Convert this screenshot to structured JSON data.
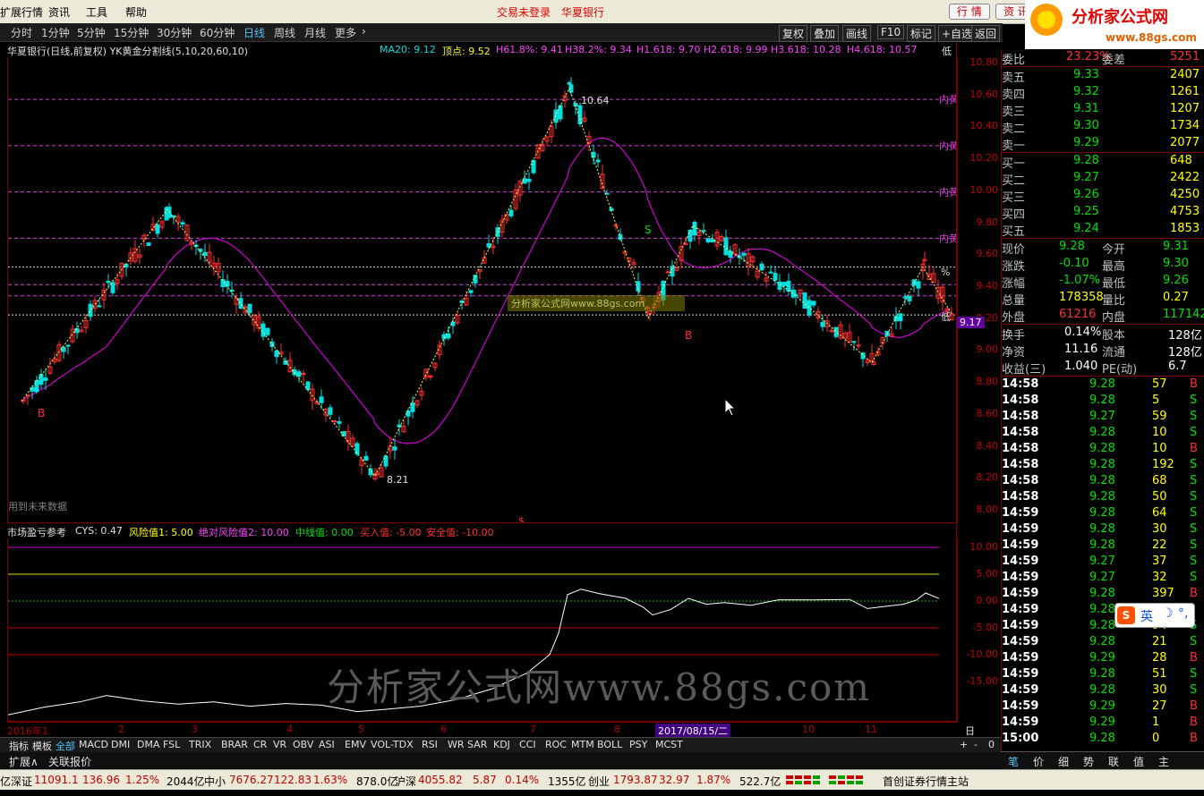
{
  "menu": {
    "items": [
      "扩展行情",
      "资讯",
      "工具",
      "帮助"
    ],
    "login_status": "交易未登录",
    "stock_name": "华夏银行",
    "btn_quote": "行 情",
    "btn_info": "资 讯"
  },
  "logo": {
    "name": "分析家公式网",
    "url": "www.88gs.com"
  },
  "period": {
    "items": [
      "分时",
      "1分钟",
      "5分钟",
      "15分钟",
      "30分钟",
      "60分钟",
      "日线",
      "周线",
      "月线",
      "更多"
    ],
    "active": "日线",
    "right_buttons": [
      "复权",
      "叠加",
      "画线",
      "F10",
      "标记",
      "+自选",
      "返回"
    ]
  },
  "chart_info": {
    "title": "华夏银行(日线,前复权) YK黄金分割线(5,10,20,60,10)",
    "ma20": "MA20: 9.12",
    "top": "顶点: 9.52",
    "h618": "H61.8%: 9.41",
    "h382": "H38.2%: 9.34",
    "h1618": "H1.618: 9.70",
    "h2618": "H2.618: 9.99",
    "h3618": "H3.618: 10.28",
    "h4618": "H4.618: 10.57",
    "low": "低"
  },
  "main_annotations": {
    "high_label": "10.64",
    "low_label": "8.21",
    "b1": "B",
    "b2": "B",
    "s1": "S",
    "future_data": "用到未来数据",
    "price_tag": "9.17",
    "inner_label": "内黄",
    "pct_label": "%",
    "low_tag": "低",
    "dollar": "$",
    "yaxis_labels": [
      "10.80",
      "10.60",
      "10.40",
      "10.20",
      "10.00",
      "9.80",
      "9.60",
      "9.40",
      "9.20",
      "9.00",
      "8.80",
      "8.60",
      "8.40",
      "8.20",
      "8.00"
    ]
  },
  "sub_info": {
    "title": "市场盈亏参考",
    "cys": "CYS: 0.47",
    "risk1": "风险值1: 5.00",
    "risk2": "绝对风险值2: 10.00",
    "mid": "中线值: 0.00",
    "buy": "买入值: -5.00",
    "safe": "安全值: -10.00",
    "yaxis_labels": [
      "10.00",
      "5.00",
      "0.00",
      "-5.00",
      "-10.00",
      "-15.00"
    ]
  },
  "date_axis": {
    "labels": [
      "2016年1",
      "2",
      "3",
      "4",
      "5",
      "6",
      "7",
      "8",
      "9",
      "10",
      "11"
    ],
    "highlight": "2017/08/15/二",
    "period_label": "日线"
  },
  "tabs": {
    "items": [
      "指标",
      "模板",
      "全部",
      "MACD",
      "DMI",
      "DMA",
      "FSL",
      "TRIX",
      "BRAR",
      "CR",
      "VR",
      "OBV",
      "ASI",
      "EMV",
      "VOL-TDX",
      "RSI",
      "WR",
      "SAR",
      "KDJ",
      "CCI",
      "ROC",
      "MTM",
      "BOLL",
      "PSY",
      "MCST"
    ],
    "active": "全部",
    "row2": [
      "扩展∧",
      "关联报价"
    ],
    "zoom": [
      "+",
      "-",
      "0"
    ]
  },
  "order_book": {
    "weibi": {
      "label": "委比",
      "value": "23.23%",
      "diff_label": "委差",
      "diff": "5251"
    },
    "asks": [
      {
        "label": "卖五",
        "price": "9.33",
        "vol": "2407"
      },
      {
        "label": "卖四",
        "price": "9.32",
        "vol": "1261"
      },
      {
        "label": "卖三",
        "price": "9.31",
        "vol": "1207"
      },
      {
        "label": "卖二",
        "price": "9.30",
        "vol": "1734"
      },
      {
        "label": "卖一",
        "price": "9.29",
        "vol": "2077"
      }
    ],
    "bids": [
      {
        "label": "买一",
        "price": "9.28",
        "vol": "648"
      },
      {
        "label": "买二",
        "price": "9.27",
        "vol": "2422"
      },
      {
        "label": "买三",
        "price": "9.26",
        "vol": "4250"
      },
      {
        "label": "买四",
        "price": "9.25",
        "vol": "4753"
      },
      {
        "label": "买五",
        "price": "9.24",
        "vol": "1853"
      }
    ]
  },
  "quote": [
    {
      "l1": "现价",
      "v1": "9.28",
      "l2": "今开",
      "v2": "9.31"
    },
    {
      "l1": "涨跌",
      "v1": "-0.10",
      "l2": "最高",
      "v2": "9.30"
    },
    {
      "l1": "涨幅",
      "v1": "-1.07%",
      "l2": "最低",
      "v2": "9.26"
    },
    {
      "l1": "总量",
      "v1": "178358",
      "l2": "量比",
      "v2": "0.27"
    },
    {
      "l1": "外盘",
      "v1": "61216",
      "l2": "内盘",
      "v2": "117142"
    }
  ],
  "fundamentals": [
    {
      "l1": "换手",
      "v1": "0.14%",
      "l2": "股本",
      "v2": "128亿"
    },
    {
      "l1": "净资",
      "v1": "11.16",
      "l2": "流通",
      "v2": "128亿"
    },
    {
      "l1": "收益(三)",
      "v1": "1.040",
      "l2": "PE(动)",
      "v2": "6.7"
    }
  ],
  "ticks": [
    {
      "t": "14:58",
      "p": "9.28",
      "v": "57",
      "d": "B"
    },
    {
      "t": "14:58",
      "p": "9.28",
      "v": "5",
      "d": "S"
    },
    {
      "t": "14:58",
      "p": "9.27",
      "v": "59",
      "d": "S"
    },
    {
      "t": "14:58",
      "p": "9.28",
      "v": "10",
      "d": "S"
    },
    {
      "t": "14:58",
      "p": "9.28",
      "v": "10",
      "d": "B"
    },
    {
      "t": "14:58",
      "p": "9.28",
      "v": "192",
      "d": "S"
    },
    {
      "t": "14:58",
      "p": "9.28",
      "v": "68",
      "d": "S"
    },
    {
      "t": "14:58",
      "p": "9.28",
      "v": "50",
      "d": "S"
    },
    {
      "t": "14:59",
      "p": "9.28",
      "v": "64",
      "d": "S"
    },
    {
      "t": "14:59",
      "p": "9.28",
      "v": "30",
      "d": "S"
    },
    {
      "t": "14:59",
      "p": "9.28",
      "v": "22",
      "d": "S"
    },
    {
      "t": "14:59",
      "p": "9.27",
      "v": "37",
      "d": "S"
    },
    {
      "t": "14:59",
      "p": "9.27",
      "v": "32",
      "d": "S"
    },
    {
      "t": "14:59",
      "p": "9.28",
      "v": "397",
      "d": "B"
    },
    {
      "t": "14:59",
      "p": "9.28",
      "v": "",
      "d": ""
    },
    {
      "t": "14:59",
      "p": "9.28",
      "v": "94",
      "d": "S"
    },
    {
      "t": "14:59",
      "p": "9.28",
      "v": "21",
      "d": "S"
    },
    {
      "t": "14:59",
      "p": "9.29",
      "v": "28",
      "d": "B"
    },
    {
      "t": "14:59",
      "p": "9.28",
      "v": "51",
      "d": "S"
    },
    {
      "t": "14:59",
      "p": "9.28",
      "v": "30",
      "d": "S"
    },
    {
      "t": "14:59",
      "p": "9.29",
      "v": "27",
      "d": "B"
    },
    {
      "t": "14:59",
      "p": "9.29",
      "v": "1",
      "d": "B"
    },
    {
      "t": "15:00",
      "p": "9.28",
      "v": "0",
      "d": "B"
    }
  ],
  "rbottom": [
    "笔",
    "价",
    "细",
    "势",
    "联",
    "值",
    "主"
  ],
  "status": {
    "sz": {
      "name": "深证",
      "v": "11091.1",
      "chg": "136.96",
      "pct": "1.25%",
      "amt": "2044亿"
    },
    "zx": {
      "name": "中小",
      "v": "7676.27",
      "chg": "122.83",
      "pct": "1.63%",
      "amt": "878.0亿"
    },
    "hs": {
      "name": "沪深",
      "v": "4055.82",
      "chg": "5.87",
      "pct": "0.14%",
      "amt": "1355亿"
    },
    "cy": {
      "name": "创业",
      "v": "1793.87",
      "chg": "32.97",
      "pct": "1.87%",
      "amt": "522.7亿"
    },
    "server": "首创证券行情主站",
    "prefix": "亿"
  },
  "watermark": "分析家公式网www.88gs.com",
  "ime_label": "英",
  "colors": {
    "up": "#ff3030",
    "down": "#00e0e0",
    "ma": "#d000d0",
    "fib": "#ff40ff",
    "bg": "#000000",
    "axis": "#c00000"
  }
}
